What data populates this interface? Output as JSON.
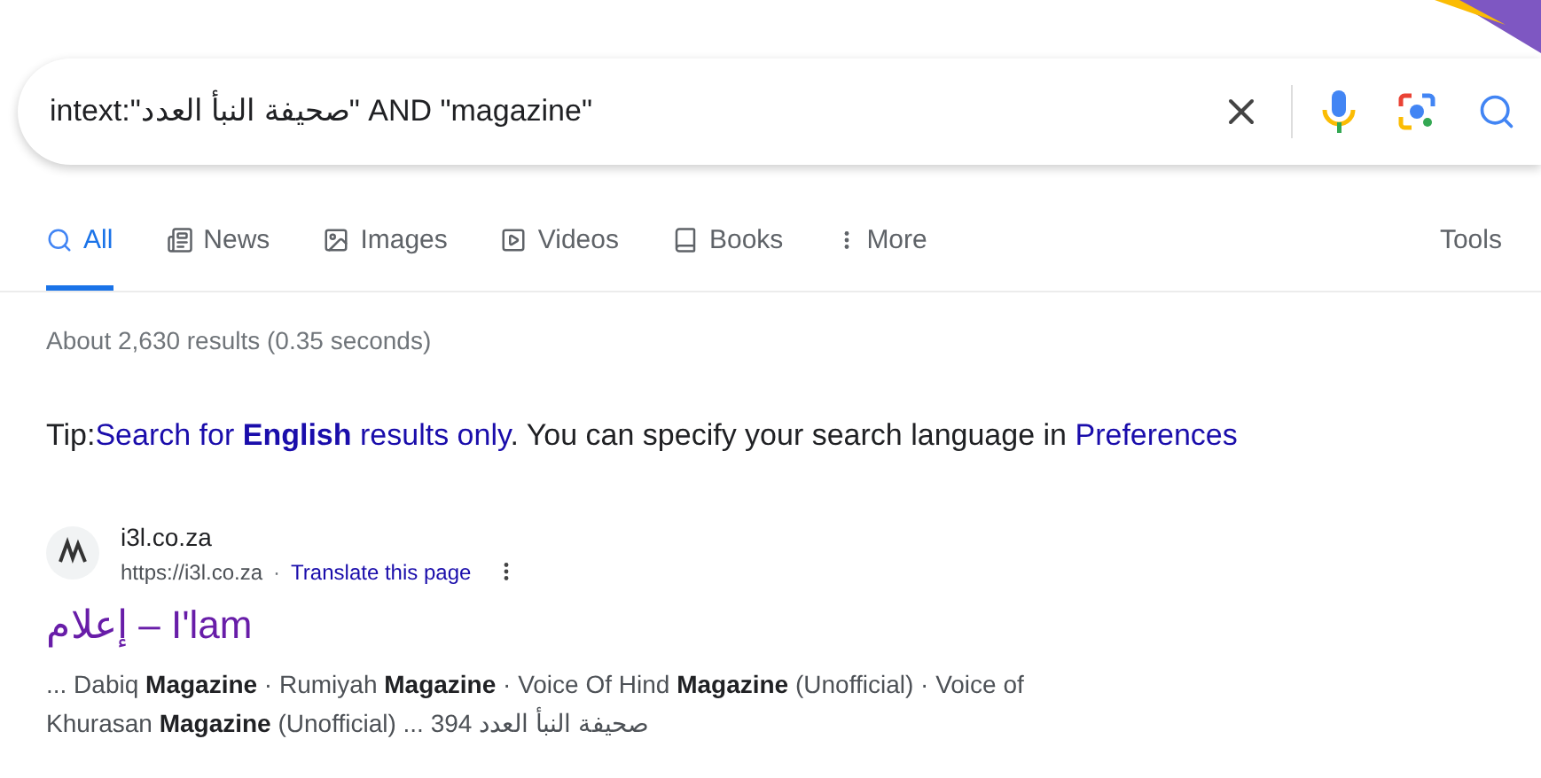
{
  "search": {
    "value": "intext:\"صحيفة النبأ العدد\" AND \"magazine\""
  },
  "tabs": [
    {
      "label": "All",
      "kind": "all",
      "selected": true
    },
    {
      "label": "News",
      "kind": "news",
      "selected": false
    },
    {
      "label": "Images",
      "kind": "images",
      "selected": false
    },
    {
      "label": "Videos",
      "kind": "videos",
      "selected": false
    },
    {
      "label": "Books",
      "kind": "books",
      "selected": false
    },
    {
      "label": "More",
      "kind": "more",
      "selected": false
    }
  ],
  "tools": "Tools",
  "result_stats": "About 2,630 results (0.35 seconds)",
  "tip": {
    "prefix": "Tip:",
    "link": "Search for **English** results only",
    "middle": ". You can specify your search language in ",
    "link2": "Preferences"
  },
  "results": [
    {
      "site": "i3l.co.za",
      "url": "https://i3l.co.za",
      "separator": "·",
      "translate": "Translate this page",
      "title": "إعلام – I'lam",
      "snippet_lines": [
        "... Dabiq **Magazine** · Rumiyah **Magazine** · Voice Of Hind **Magazine** (Unofficial) · Voice of",
        "Khurasan **Magazine** (Unofficial) ... صحيفة النبأ العدد 394"
      ]
    }
  ]
}
